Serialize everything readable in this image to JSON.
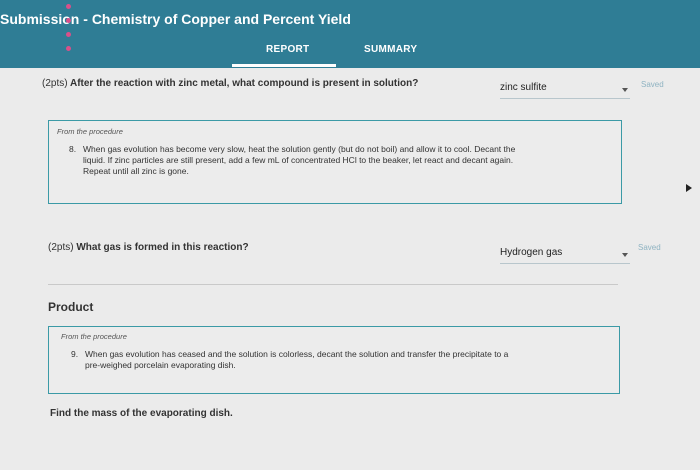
{
  "header": {
    "title_prefix": "Submission",
    "title_separator": " - ",
    "title_main": "Chemistry of Copper and Percent Yield",
    "tabs": [
      {
        "label": "REPORT",
        "active": true
      },
      {
        "label": "SUMMARY",
        "active": false
      }
    ]
  },
  "questions": [
    {
      "points": "(2pts)",
      "text": "After the reaction with zinc metal, what compound is present in solution?",
      "answer": "zinc sulfite",
      "status": "Saved"
    },
    {
      "points": "(2pts)",
      "text": "What gas is formed in this reaction?",
      "answer": "Hydrogen gas",
      "status": "Saved"
    }
  ],
  "procedures": [
    {
      "label": "From the procedure",
      "step_number": "8.",
      "lines": [
        "When gas evolution has become very slow, heat the solution gently (but do not boil) and allow it to cool. Decant the",
        "liquid. If zinc particles are still present, add a few mL of concentrated HCl to the beaker, let react and decant again.",
        "Repeat until all zinc is gone."
      ]
    },
    {
      "label": "From the procedure",
      "step_number": "9.",
      "lines": [
        "When gas evolution has ceased and the solution is colorless, decant the solution and transfer the precipitate to a",
        "pre-weighed porcelain evaporating dish."
      ]
    }
  ],
  "product_section": {
    "title": "Product",
    "question": "Find the mass of the evaporating dish."
  },
  "colors": {
    "header": "#2f7d95",
    "accent_border": "#3b9aa6",
    "dots": "#d9508a",
    "saved_text": "#8fb3c2"
  }
}
